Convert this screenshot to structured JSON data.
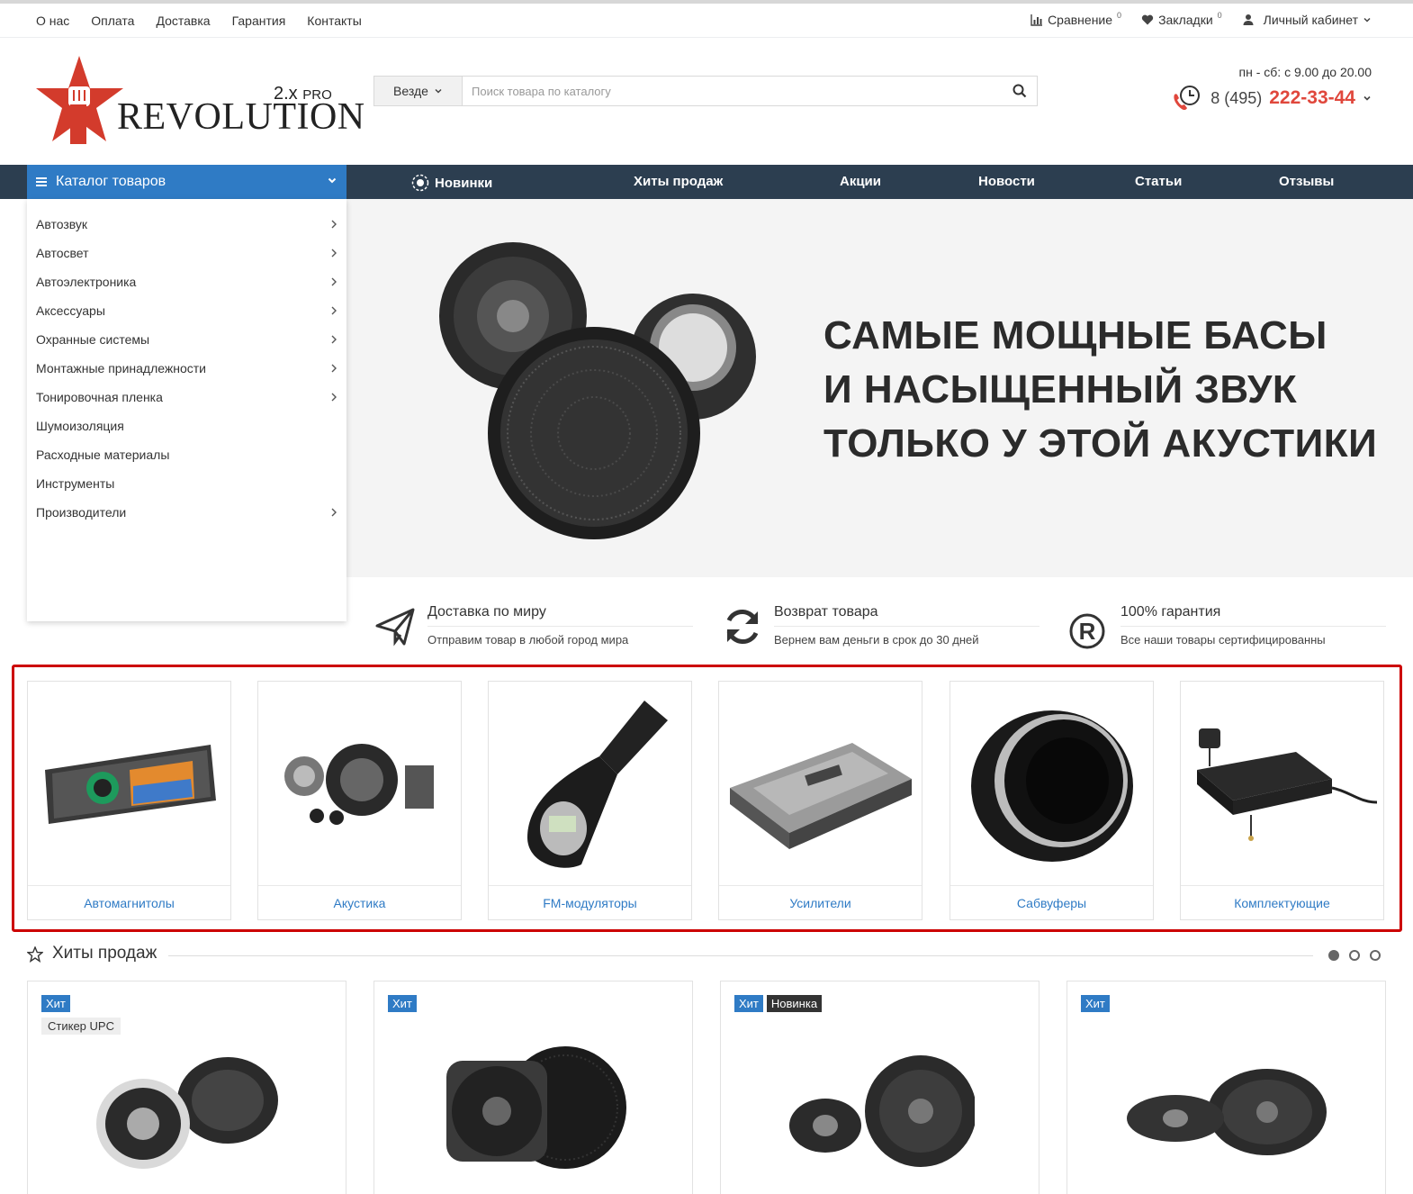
{
  "topbar": {
    "links": [
      "О нас",
      "Оплата",
      "Доставка",
      "Гарантия",
      "Контакты"
    ],
    "compare_label": "Сравнение",
    "compare_count": "0",
    "bookmarks_label": "Закладки",
    "bookmarks_count": "0",
    "account_label": "Личный кабинет"
  },
  "logo": {
    "brand": "REVOLUTION",
    "version": "2.x",
    "edition": "PRO"
  },
  "search": {
    "scope": "Везде",
    "placeholder": "Поиск товара по каталогу"
  },
  "contact": {
    "hours": "пн - сб: с 9.00 до 20.00",
    "phone_prefix": "8 (495)",
    "phone_number": "222-33-44"
  },
  "nav": {
    "catalog_label": "Каталог товаров",
    "items": [
      "Новинки",
      "Хиты продаж",
      "Акции",
      "Новости",
      "Статьи",
      "Отзывы"
    ]
  },
  "catalog_menu": [
    {
      "label": "Автозвук",
      "has_sub": true
    },
    {
      "label": "Автосвет",
      "has_sub": true
    },
    {
      "label": "Автоэлектроника",
      "has_sub": true
    },
    {
      "label": "Аксессуары",
      "has_sub": true
    },
    {
      "label": "Охранные системы",
      "has_sub": true
    },
    {
      "label": "Монтажные принадлежности",
      "has_sub": true
    },
    {
      "label": "Тонировочная пленка",
      "has_sub": true
    },
    {
      "label": "Шумоизоляция",
      "has_sub": false
    },
    {
      "label": "Расходные материалы",
      "has_sub": false
    },
    {
      "label": "Инструменты",
      "has_sub": false
    },
    {
      "label": "Производители",
      "has_sub": true
    }
  ],
  "hero": {
    "lines": [
      "САМЫЕ МОЩНЫЕ БАСЫ",
      "И НАСЫЩЕННЫЙ ЗВУК",
      "ТОЛЬКО У ЭТОЙ АКУСТИКИ"
    ]
  },
  "features": [
    {
      "title": "Доставка по миру",
      "text": "Отправим товар в любой город мира",
      "icon": "paper-plane-icon"
    },
    {
      "title": "Возврат товара",
      "text": "Вернем вам деньги в срок до 30 дней",
      "icon": "refresh-icon"
    },
    {
      "title": "100% гарантия",
      "text": "Все наши товары сертифицированны",
      "icon": "registered-icon"
    }
  ],
  "categories": [
    "Автомагнитолы",
    "Акустика",
    "FM-модуляторы",
    "Усилители",
    "Сабвуферы",
    "Комплектующие"
  ],
  "hits": {
    "title": "Хиты продаж",
    "badge_hit": "Хит",
    "badge_new": "Новинка",
    "sticker": "Стикер UPC"
  },
  "colors": {
    "accent": "#2f7bc5",
    "nav_bg": "#2c3e50",
    "phone": "#e0473c",
    "highlight": "#cc0000"
  }
}
